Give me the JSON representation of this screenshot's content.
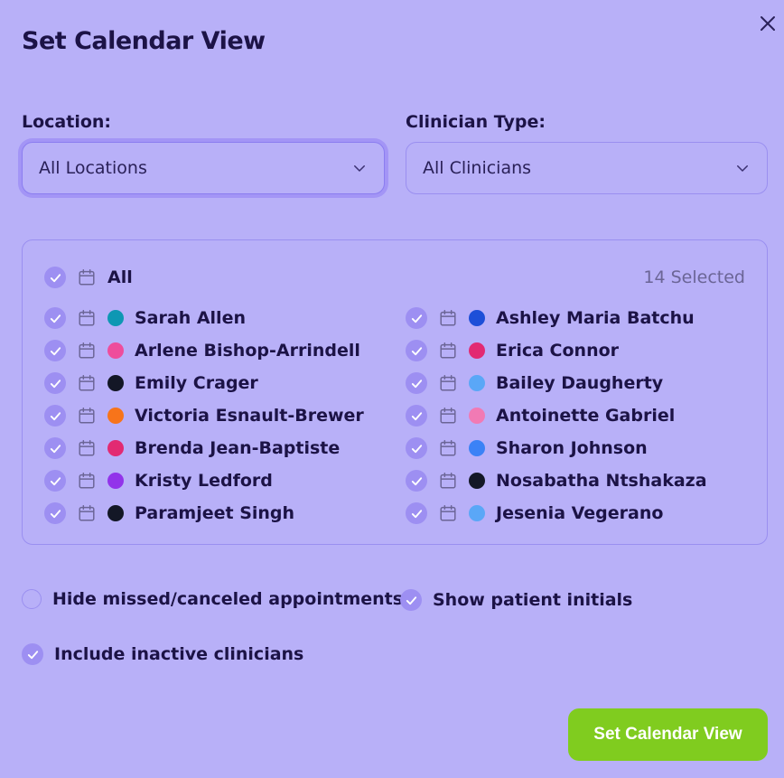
{
  "dialog": {
    "title": "Set Calendar View"
  },
  "location": {
    "label": "Location:",
    "value": "All Locations"
  },
  "clinician_type": {
    "label": "Clinician Type:",
    "value": "All Clinicians"
  },
  "clinicians": {
    "all_label": "All",
    "selected_count": "14 Selected",
    "left": [
      {
        "name": "Sarah Allen",
        "color": "#0e97b3"
      },
      {
        "name": "Arlene Bishop-Arrindell",
        "color": "#ee4d9c"
      },
      {
        "name": "Emily Crager",
        "color": "#131726"
      },
      {
        "name": "Victoria Esnault-Brewer",
        "color": "#f7741a"
      },
      {
        "name": "Brenda Jean-Baptiste",
        "color": "#e22a72"
      },
      {
        "name": "Kristy Ledford",
        "color": "#9233ea"
      },
      {
        "name": "Paramjeet Singh",
        "color": "#131726"
      }
    ],
    "right": [
      {
        "name": "Ashley Maria Batchu",
        "color": "#1d4fd8"
      },
      {
        "name": "Erica Connor",
        "color": "#e22a72"
      },
      {
        "name": "Bailey Daugherty",
        "color": "#5aa7f7"
      },
      {
        "name": "Antoinette Gabriel",
        "color": "#f17ab4"
      },
      {
        "name": "Sharon Johnson",
        "color": "#3b82f6"
      },
      {
        "name": "Nosabatha Ntshakaza",
        "color": "#131726"
      },
      {
        "name": "Jesenia Vegerano",
        "color": "#5aa7f7"
      }
    ]
  },
  "options": {
    "hide_missed": {
      "label": "Hide missed/canceled appointments",
      "checked": false
    },
    "show_initials": {
      "label": "Show patient initials",
      "checked": true
    },
    "include_inactive": {
      "label": "Include inactive clinicians",
      "checked": true
    }
  },
  "submit": {
    "label": "Set Calendar View"
  },
  "colors": {
    "background": "#b8b0f8",
    "accent": "#80cc1f",
    "check": "#9d8ff2"
  }
}
